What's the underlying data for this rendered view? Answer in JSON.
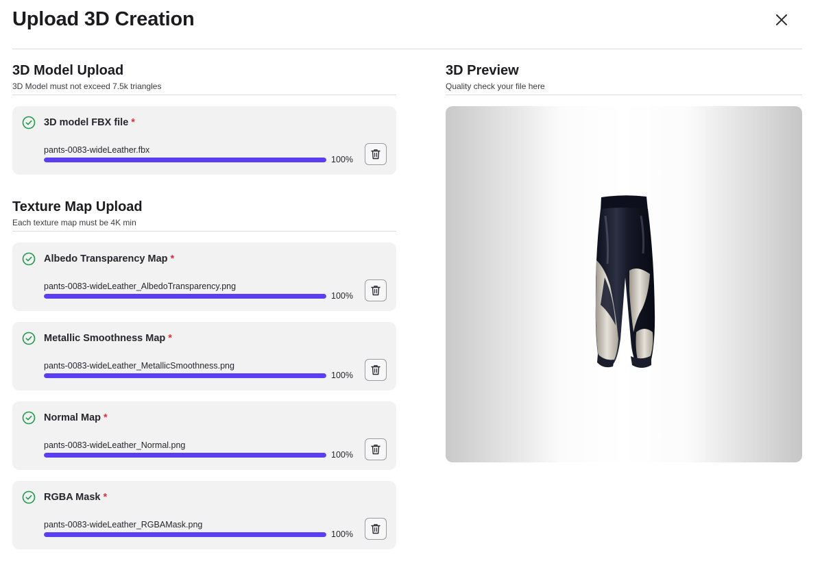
{
  "modal": {
    "title": "Upload 3D Creation",
    "close_icon": "close-icon"
  },
  "model_section": {
    "title": "3D Model Upload",
    "subtitle": "3D Model must not exceed 7.5k triangles"
  },
  "texture_section": {
    "title": "Texture Map Upload",
    "subtitle": "Each texture map must be 4K min"
  },
  "preview_section": {
    "title": "3D Preview",
    "subtitle": "Quality check your file here"
  },
  "required_marker": "*",
  "colors": {
    "accent": "#5b3df2",
    "success": "#1f9a4c",
    "required": "#e0303a",
    "card_bg": "#f2f2f3"
  },
  "uploads": [
    {
      "title": "3D model FBX file",
      "file": "pants-0083-wideLeather.fbx",
      "progress": 100,
      "progress_label": "100%",
      "status": "complete"
    },
    {
      "title": "Albedo Transparency Map",
      "file": "pants-0083-wideLeather_AlbedoTransparency.png",
      "progress": 100,
      "progress_label": "100%",
      "status": "complete"
    },
    {
      "title": "Metallic Smoothness Map",
      "file": "pants-0083-wideLeather_MetallicSmoothness.png",
      "progress": 100,
      "progress_label": "100%",
      "status": "complete"
    },
    {
      "title": "Normal Map",
      "file": "pants-0083-wideLeather_Normal.png",
      "progress": 100,
      "progress_label": "100%",
      "status": "complete"
    },
    {
      "title": "RGBA Mask",
      "file": "pants-0083-wideLeather_RGBAMask.png",
      "progress": 100,
      "progress_label": "100%",
      "status": "complete"
    }
  ]
}
